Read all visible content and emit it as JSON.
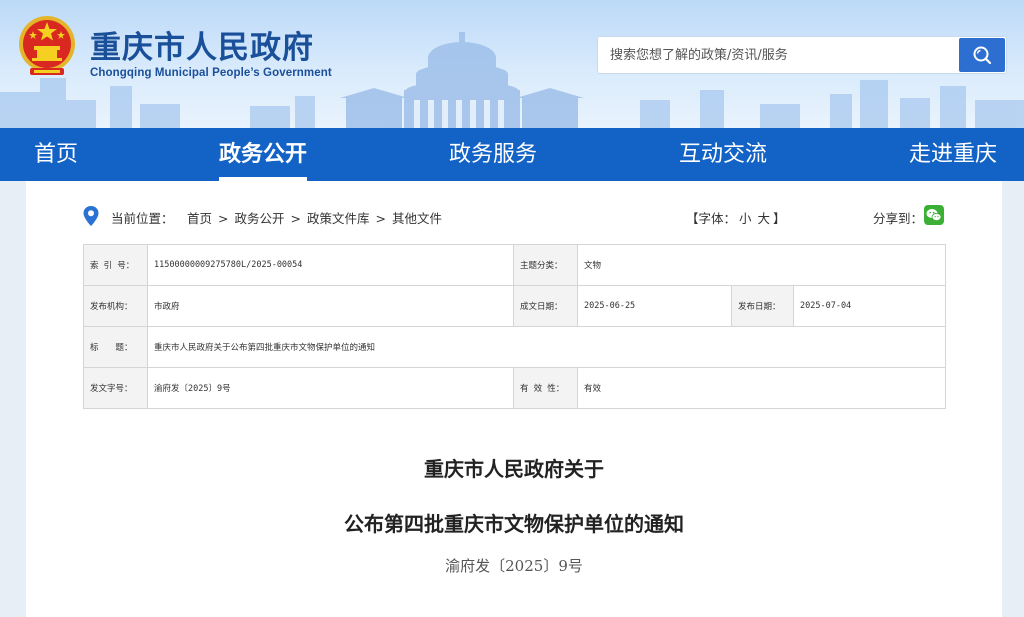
{
  "header": {
    "title": "重庆市人民政府",
    "subtitle": "Chongqing Municipal People’s Government",
    "search_placeholder": "搜索您想了解的政策/资讯/服务"
  },
  "nav": {
    "items": [
      {
        "label": "首页"
      },
      {
        "label": "政务公开",
        "active": true
      },
      {
        "label": "政务服务"
      },
      {
        "label": "互动交流"
      },
      {
        "label": "走进重庆"
      }
    ]
  },
  "breadcrumb": {
    "label": "当前位置：",
    "items": [
      "首页",
      "政务公开",
      "政策文件库",
      "其他文件"
    ],
    "separator": ">"
  },
  "font_size": {
    "prefix": "【字体：",
    "small": "小",
    "large": "大",
    "suffix": "】"
  },
  "share": {
    "label": "分享到："
  },
  "meta": {
    "index_label": "索 引 号：",
    "index_value": "11500000009275780L/2025-00054",
    "topic_label": "主题分类：",
    "topic_value": "文物",
    "issuer_label": "发布机构：",
    "issuer_value": "市政府",
    "written_label": "成文日期：",
    "written_value": "2025-06-25",
    "published_label": "发布日期：",
    "published_value": "2025-07-04",
    "title_label": "标　　题：",
    "title_value": "重庆市人民政府关于公布第四批重庆市文物保护单位的通知",
    "docno_label": "发文字号：",
    "docno_value": "渝府发〔2025〕9号",
    "validity_label": "有 效 性：",
    "validity_value": "有效"
  },
  "document": {
    "title_line1": "重庆市人民政府关于",
    "title_line2": "公布第四批重庆市文物保护单位的通知",
    "number": "渝府发〔2025〕9号"
  },
  "colors": {
    "nav_bg": "#1362c6",
    "title_blue": "#1a4f9a",
    "search_btn": "#2c6fd1",
    "wechat_green": "#3cb034"
  }
}
